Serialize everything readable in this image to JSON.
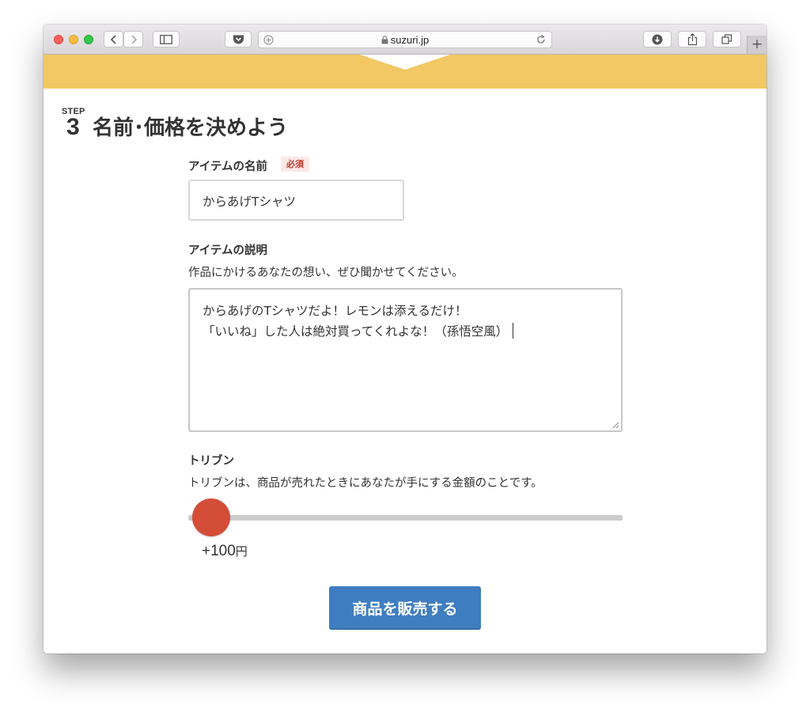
{
  "browser": {
    "url": "suzuri.jp",
    "new_tab_glyph": "+",
    "icons": [
      "back-icon",
      "forward-icon",
      "sidebar-icon",
      "pocket-icon",
      "add-icon",
      "lock-icon",
      "reload-icon",
      "download-icon",
      "share-icon",
      "tabs-icon",
      "new-tab-icon"
    ]
  },
  "step": {
    "label": "STEP",
    "number": "3",
    "title": "名前･価格を決めよう"
  },
  "item_name": {
    "label": "アイテムの名前",
    "required_badge": "必須",
    "value": "からあげTシャツ"
  },
  "item_description": {
    "label": "アイテムの説明",
    "hint": "作品にかけるあなたの想い、ぜひ聞かせてください。",
    "lines": [
      "からあげのTシャツだよ！レモンは添えるだけ！",
      "「いいね」した人は絶対買ってくれよな！（孫悟空風）"
    ]
  },
  "tribun": {
    "label": "トリブン",
    "hint": "トリブンは、商品が売れたときにあなたが手にする金額のことです。",
    "value": "+100",
    "unit": "円",
    "slider_fraction": 0.05
  },
  "submit_label": "商品を販売する",
  "colors": {
    "banner": "#f2c864",
    "slider_thumb": "#d44d37",
    "button": "#3f7dc1",
    "badge_bg": "#fde8e6",
    "badge_text": "#c0392b"
  }
}
